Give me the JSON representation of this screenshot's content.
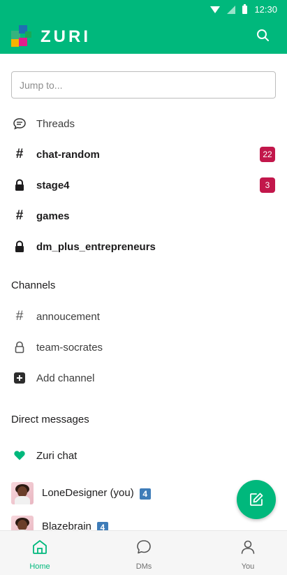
{
  "status_bar": {
    "time": "12:30"
  },
  "app_bar": {
    "brand": "ZURI"
  },
  "search": {
    "placeholder": "Jump to..."
  },
  "quick_items": [
    {
      "label": "Threads",
      "icon": "threads-icon"
    },
    {
      "label": "chat-random",
      "icon": "hash-icon",
      "badge": "22"
    },
    {
      "label": "stage4",
      "icon": "lock-icon",
      "badge": "3"
    },
    {
      "label": "games",
      "icon": "hash-icon"
    },
    {
      "label": "dm_plus_entrepreneurs",
      "icon": "lock-icon"
    }
  ],
  "channels": {
    "header": "Channels",
    "items": [
      {
        "label": "annoucement",
        "icon": "hash-icon"
      },
      {
        "label": "team-socrates",
        "icon": "lock-outline-icon"
      },
      {
        "label": "Add channel",
        "icon": "plus-square-icon"
      }
    ]
  },
  "direct_messages": {
    "header": "Direct messages",
    "zuri_chat": "Zuri chat",
    "items": [
      {
        "name": "LoneDesigner (you)",
        "count": "4"
      },
      {
        "name": "Blazebrain",
        "count": "4"
      }
    ]
  },
  "bottom_nav": {
    "home": "Home",
    "dms": "DMs",
    "you": "You"
  },
  "colors": {
    "brand": "#00b87c",
    "badge": "#c2174b",
    "count_badge": "#3e7cb8"
  }
}
